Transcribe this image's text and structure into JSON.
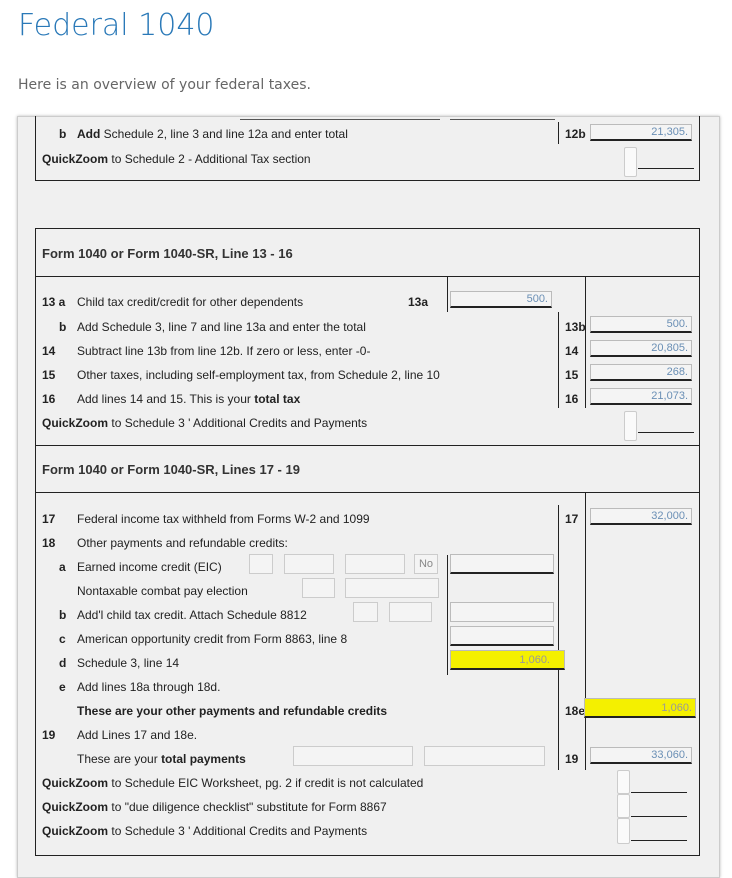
{
  "page": {
    "title": "Federal 1040",
    "subtitle": "Here is an overview of your federal taxes."
  },
  "section12": {
    "b_letter": "b",
    "b_bold": "Add",
    "b_text": "Schedule 2, line 3 and line 12a and enter total",
    "b_code": "12b",
    "b_value": "21,305.",
    "qz_bold": "QuickZoom",
    "qz_text": "to Schedule 2 - Additional Tax section"
  },
  "section13": {
    "header": "Form 1040 or Form 1040-SR, Line 13 - 16",
    "l13a_num": "13 a",
    "l13a_text": "Child tax credit/credit for other dependents",
    "l13a_code": "13a",
    "l13a_value": "500.",
    "l13b_letter": "b",
    "l13b_text": "Add Schedule 3, line 7 and line 13a and enter the total",
    "l13b_code": "13b",
    "l13b_value": "500.",
    "l14_num": "14",
    "l14_text": "Subtract line 13b from line 12b. If zero or less, enter -0-",
    "l14_code": "14",
    "l14_value": "20,805.",
    "l15_num": "15",
    "l15_text": "Other taxes, including self-employment tax, from Schedule 2, line 10",
    "l15_code": "15",
    "l15_value": "268.",
    "l16_num": "16",
    "l16_text": "Add lines 14 and 15. This is your",
    "l16_bold": "total tax",
    "l16_code": "16",
    "l16_value": "21,073.",
    "qz_bold": "QuickZoom",
    "qz_text": "to Schedule 3 ' Additional Credits and Payments"
  },
  "section17": {
    "header": "Form 1040 or Form 1040-SR, Lines 17 - 19",
    "l17_num": "17",
    "l17_text": "Federal income tax withheld from Forms W-2 and 1099",
    "l17_code": "17",
    "l17_value": "32,000.",
    "l18_num": "18",
    "l18_text": "Other payments and refundable credits:",
    "l18a_letter": "a",
    "l18a_text": "Earned income credit (EIC)",
    "l18a_no": "No",
    "combat_text": "Nontaxable combat pay election",
    "l18b_letter": "b",
    "l18b_text": "Add'l child tax credit. Attach Schedule 8812",
    "l18c_letter": "c",
    "l18c_text": "American opportunity credit from Form 8863, line 8",
    "l18d_letter": "d",
    "l18d_text": "Schedule 3, line 14",
    "l18d_value": "1,060.",
    "l18e_letter": "e",
    "l18e_text": "Add lines 18a through 18d.",
    "l18e_bold": "These are your other payments and refundable credits",
    "l18e_code": "18e",
    "l18e_value": "1,060.",
    "l19_num": "19",
    "l19_text": "Add Lines 17 and 18e.",
    "l19_text2": "These are your",
    "l19_bold": "total payments",
    "l19_code": "19",
    "l19_value": "33,060.",
    "qz1_bold": "QuickZoom",
    "qz1_text": "to Schedule EIC Worksheet, pg. 2 if credit is not calculated",
    "qz2_bold": "QuickZoom",
    "qz2_text": "to \"due diligence checklist\" substitute for Form 8867",
    "qz3_bold": "QuickZoom",
    "qz3_text": "to Schedule 3 ' Additional Credits and Payments"
  },
  "colors": {
    "title": "#2a79b8",
    "highlight": "#f4f000"
  }
}
